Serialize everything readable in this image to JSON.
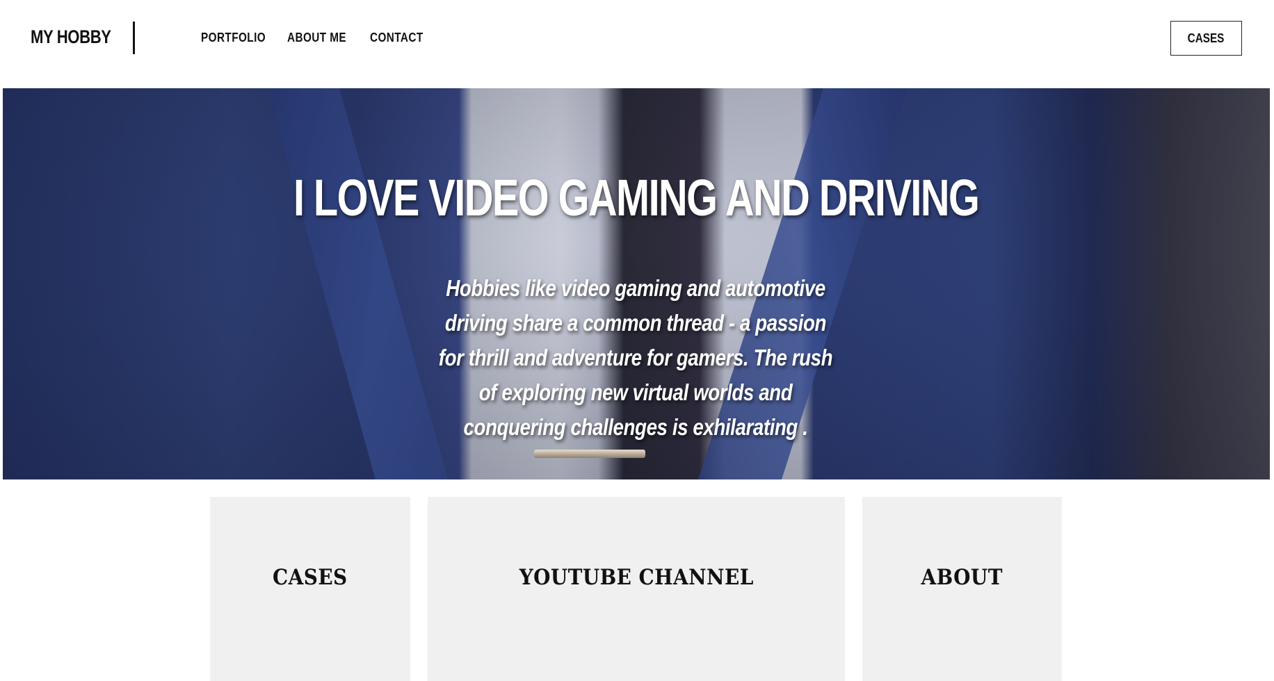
{
  "header": {
    "logo": "MY HOBBY",
    "nav": [
      {
        "label": "PORTFOLIO"
      },
      {
        "label": "ABOUT ME"
      },
      {
        "label": "CONTACT"
      }
    ],
    "cta_label": "CASES"
  },
  "hero": {
    "title": "I LOVE VIDEO GAMING AND DRIVING",
    "text": "Hobbies like video gaming and automotive driving share a common thread - a passion for thrill and adventure for gamers. The rush of exploring new virtual worlds and conquering challenges is exhilarating ."
  },
  "cards": [
    {
      "label": "CASES"
    },
    {
      "label": "YOUTUBE CHANNEL"
    },
    {
      "label": "ABOUT"
    }
  ]
}
